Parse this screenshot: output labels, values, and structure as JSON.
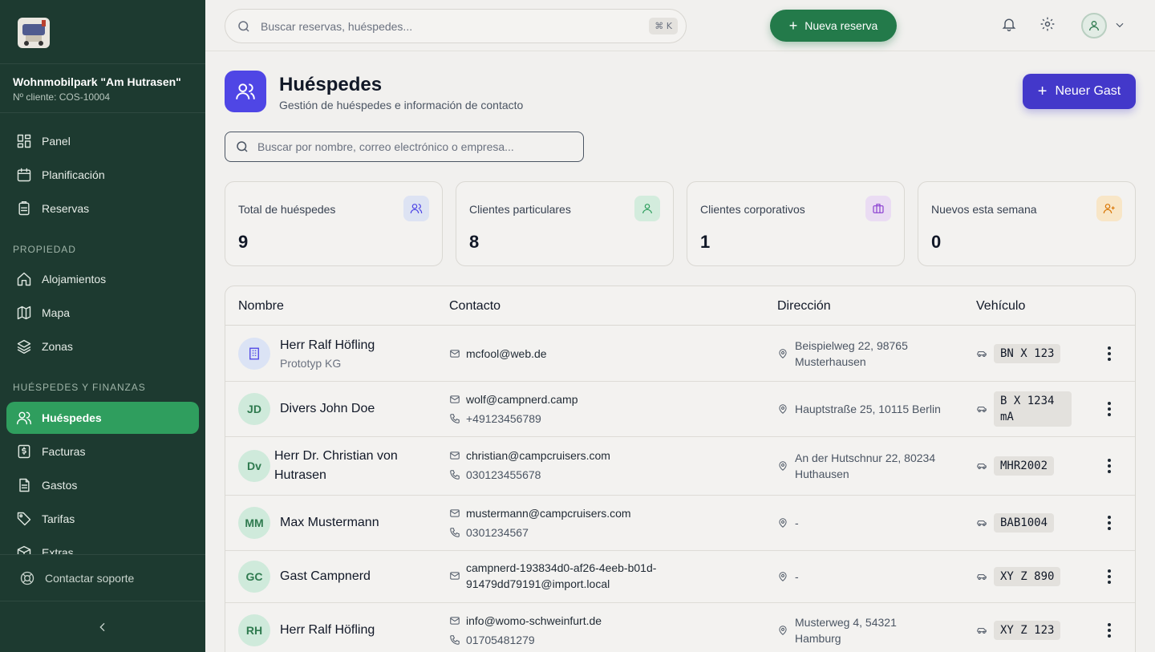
{
  "sidebar": {
    "tenant_name": "Wohnmobilpark \"Am Hutrasen\"",
    "tenant_number": "Nº cliente: COS-10004",
    "nav_top": [
      {
        "label": "Panel",
        "icon": "dashboard-icon"
      },
      {
        "label": "Planificación",
        "icon": "calendar-icon"
      },
      {
        "label": "Reservas",
        "icon": "clipboard-icon"
      }
    ],
    "section_property": "PROPIEDAD",
    "nav_property": [
      {
        "label": "Alojamientos",
        "icon": "home-icon"
      },
      {
        "label": "Mapa",
        "icon": "map-icon"
      },
      {
        "label": "Zonas",
        "icon": "layers-icon"
      }
    ],
    "section_finance": "HUÉSPEDES Y FINANZAS",
    "nav_finance": [
      {
        "label": "Huéspedes",
        "icon": "users-icon",
        "active": true
      },
      {
        "label": "Facturas",
        "icon": "invoice-icon"
      },
      {
        "label": "Gastos",
        "icon": "file-icon"
      },
      {
        "label": "Tarifas",
        "icon": "tag-icon"
      },
      {
        "label": "Extras",
        "icon": "box-icon"
      }
    ],
    "support_label": "Contactar soporte"
  },
  "topbar": {
    "search_placeholder": "Buscar reservas, huéspedes...",
    "shortcut": "⌘ K",
    "new_booking_label": "Nueva reserva"
  },
  "page": {
    "title": "Huéspedes",
    "subtitle": "Gestión de huéspedes e información de contacto",
    "new_guest_label": "Neuer Gast",
    "search_placeholder": "Buscar por nombre, correo electrónico o empresa..."
  },
  "stats": [
    {
      "label": "Total de huéspedes",
      "value": "9",
      "icon": "users-icon",
      "color": "#4f46e5",
      "bg": "#dde3f3"
    },
    {
      "label": "Clientes particulares",
      "value": "8",
      "icon": "user-icon",
      "color": "#2f9e5e",
      "bg": "#d3ecdd"
    },
    {
      "label": "Clientes corporativos",
      "value": "1",
      "icon": "briefcase-icon",
      "color": "#8b3fd1",
      "bg": "#eadcf3"
    },
    {
      "label": "Nuevos esta semana",
      "value": "0",
      "icon": "user-plus-icon",
      "color": "#d97706",
      "bg": "#f8e6c7"
    }
  ],
  "table": {
    "headers": {
      "name": "Nombre",
      "contact": "Contacto",
      "address": "Dirección",
      "vehicle": "Vehículo"
    },
    "rows": [
      {
        "initials": "",
        "name": "Herr Ralf Höfling",
        "company": "Prototyp KG",
        "email": "mcfool@web.de",
        "phone": "",
        "address": "Beispielweg 22, 98765\nMusterhausen",
        "vehicle": "BN X 123"
      },
      {
        "initials": "JD",
        "name": "Divers John Doe",
        "company": "",
        "email": "wolf@campnerd.camp",
        "phone": "+49123456789",
        "address": "Hauptstraße 25, 10115 Berlin",
        "vehicle": "B X 1234\nmA"
      },
      {
        "initials": "Dv",
        "name": "Herr Dr. Christian von\nHutrasen",
        "company": "",
        "email": "christian@campcruisers.com",
        "phone": "030123455678",
        "address": "An der Hutschnur 22, 80234\nHuthausen",
        "vehicle": "MHR2002"
      },
      {
        "initials": "MM",
        "name": "Max Mustermann",
        "company": "",
        "email": "mustermann@campcruisers.com",
        "phone": "0301234567",
        "address": "-",
        "vehicle": "BAB1004"
      },
      {
        "initials": "GC",
        "name": "Gast Campnerd",
        "company": "",
        "email": "campnerd-193834d0-af26-4eeb-b01d-\n91479dd79191@import.local",
        "phone": "",
        "address": "-",
        "vehicle": "XY Z 890"
      },
      {
        "initials": "RH",
        "name": "Herr Ralf Höfling",
        "company": "",
        "email": "info@womo-schweinfurt.de",
        "phone": "01705481279",
        "address": "Musterweg 4, 54321\nHamburg",
        "vehicle": "XY Z 123"
      }
    ]
  }
}
